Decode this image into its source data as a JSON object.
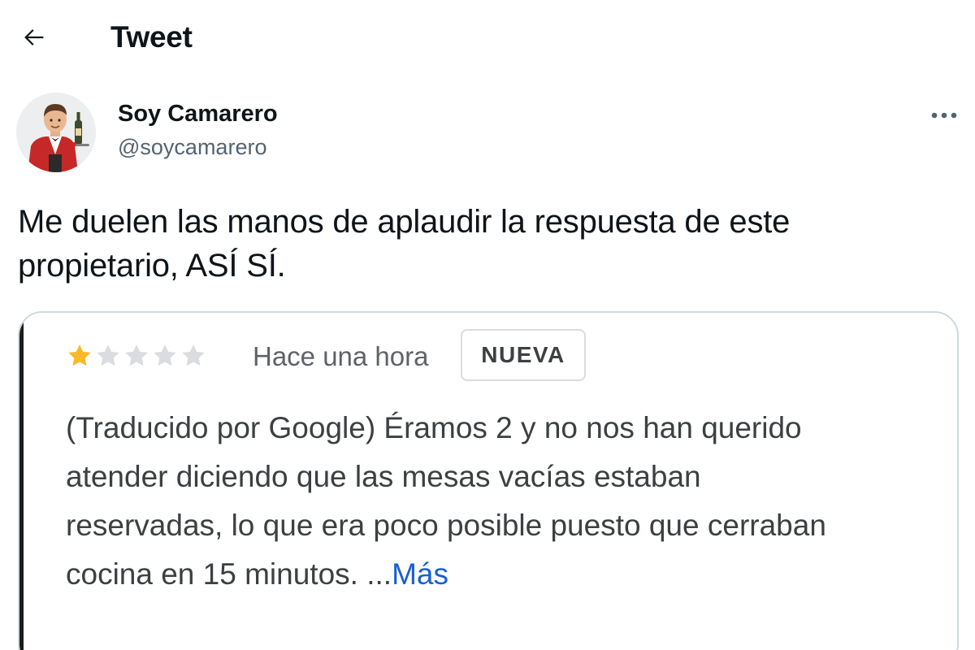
{
  "header": {
    "title": "Tweet",
    "back_icon": "arrow-left-icon"
  },
  "author": {
    "display_name": "Soy Camarero",
    "handle": "@soycamarero",
    "avatar_icon": "waiter-avatar",
    "more_icon": "more-horizontal-icon"
  },
  "tweet": {
    "text_line1": "Me duelen las manos de aplaudir la respuesta de este",
    "text_line2": "propietario, ASÍ SÍ."
  },
  "review": {
    "rating": 1,
    "rating_max": 5,
    "time": "Hace una hora",
    "badge": "NUEVA",
    "text_line1": "(Traducido por Google) Éramos 2 y no nos han querido",
    "text_line2": "atender diciendo que las mesas vacías estaban",
    "text_line3": "reservadas, lo que era poco posible puesto que cerraban",
    "text_line4": "cocina en 15 minutos. ",
    "ellipsis": "...",
    "more_link": "Más"
  },
  "colors": {
    "star_filled": "#f7b928",
    "star_empty": "#dadce0",
    "link": "#1a5fd1",
    "secondary_text": "#536471"
  }
}
